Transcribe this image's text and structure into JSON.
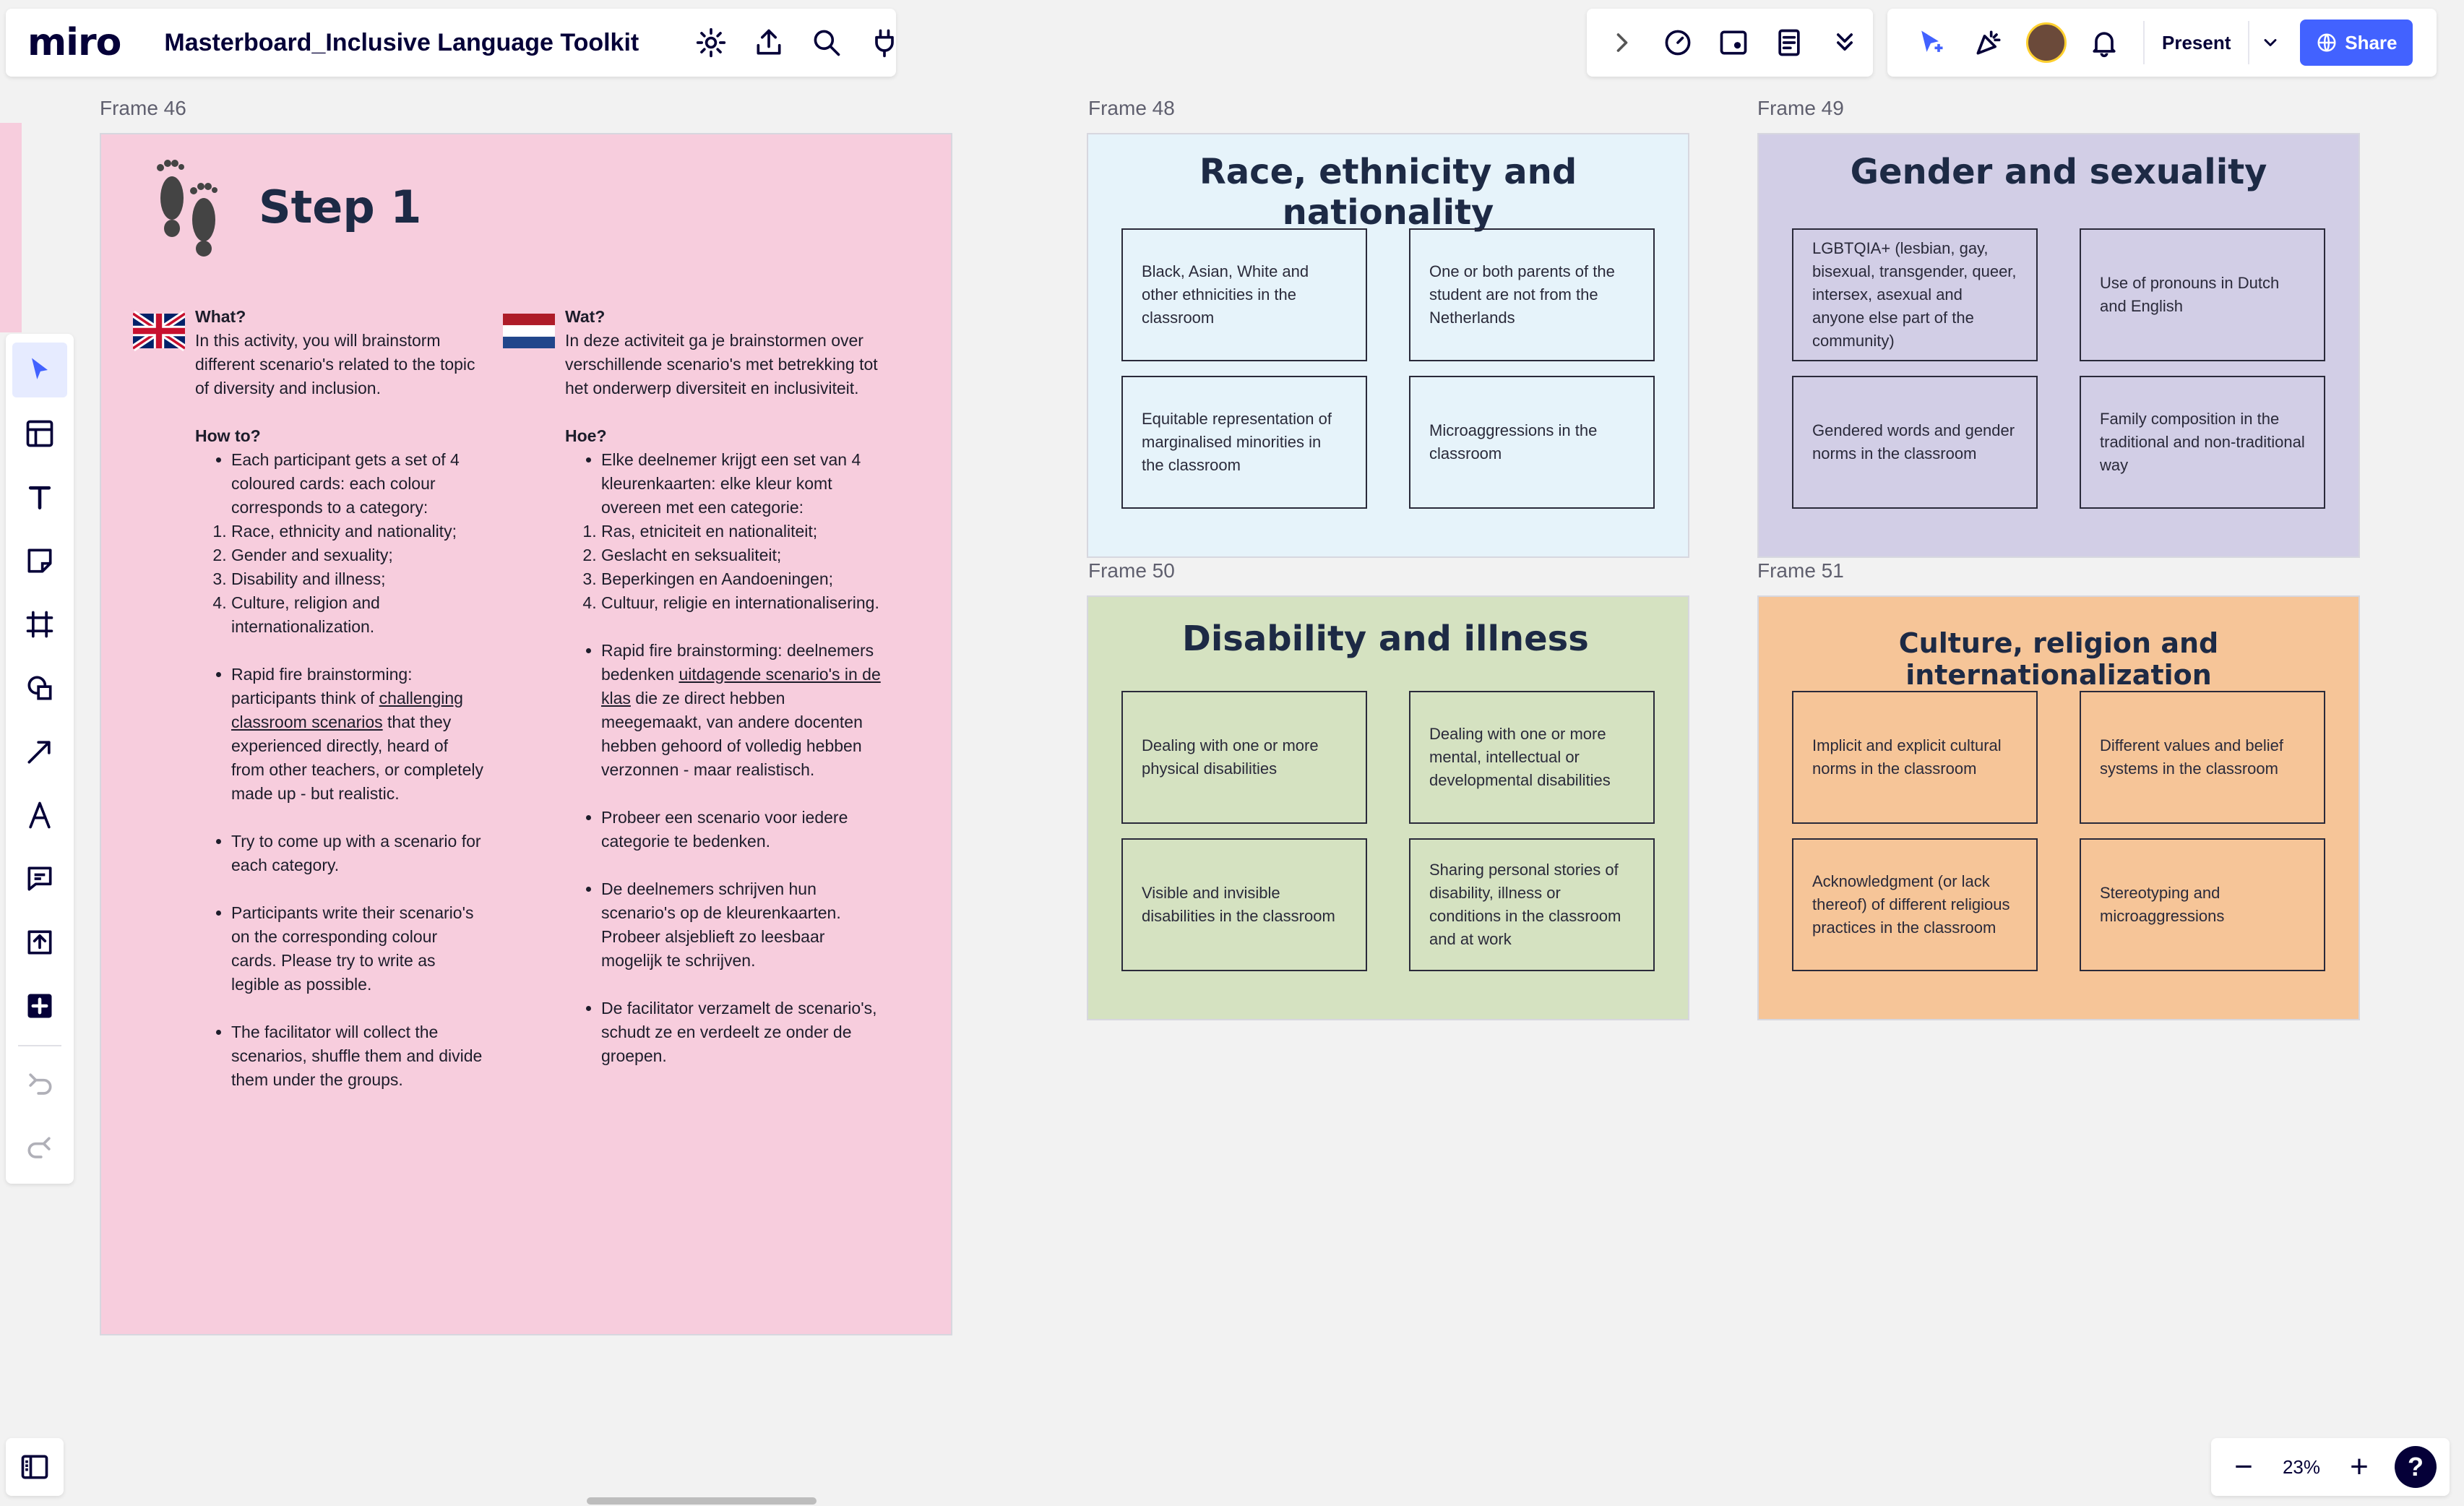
{
  "app": {
    "logo": "miro",
    "board_title": "Masterboard_Inclusive Language Toolkit",
    "present_label": "Present",
    "share_label": "Share",
    "zoom_level": "23%",
    "zoom_out": "−",
    "zoom_in": "+",
    "help": "?"
  },
  "frames": {
    "f46": {
      "label": "Frame 46",
      "step_title": "Step 1",
      "en": {
        "what_heading": "What?",
        "what_text": "In this activity, you will brainstorm different scenario's related to the topic of diversity and inclusion.",
        "howto_heading": "How to?",
        "bullet1": "Each participant gets a set of 4 coloured cards: each colour corresponds to a category:",
        "categories": [
          "Race, ethnicity and nationality;",
          "Gender and sexuality;",
          " Disability and illness;",
          "Culture, religion and internationalization."
        ],
        "bullet2_pre": "Rapid fire brainstorming: participants think of ",
        "bullet2_link": "challenging classroom scenarios",
        "bullet2_post": " that they experienced directly, heard of from other teachers, or completely made up - but realistic.",
        "bullet3": "Try to come up with a scenario for each category.",
        "bullet4": "Participants write their scenario's on the corresponding colour cards. Please try to write as legible as possible.",
        "bullet5": "The facilitator will collect the scenarios, shuffle them and divide them under the groups."
      },
      "nl": {
        "what_heading": "Wat?",
        "what_text": "In deze activiteit ga je brainstormen over verschillende scenario's met betrekking tot het onderwerp diversiteit en inclusiviteit.",
        "howto_heading": "Hoe?",
        "bullet1": "Elke deelnemer krijgt een set van 4 kleurenkaarten: elke kleur komt overeen met een categorie:",
        "categories": [
          "Ras, etniciteit en nationaliteit;",
          "Geslacht en seksualiteit;",
          "Beperkingen en Aandoeningen;",
          "Cultuur, religie en internationalisering."
        ],
        "bullet2_pre": "Rapid fire brainstorming: deelnemers bedenken ",
        "bullet2_link": "uitdagende scenario's in de klas",
        "bullet2_post": " die ze direct hebben meegemaakt, van andere docenten hebben gehoord of volledig hebben verzonnen - maar realistisch.",
        "bullet3": "Probeer een scenario voor iedere categorie te bedenken.",
        "bullet4": "De deelnemers schrijven hun scenario's op de kleurenkaarten. Probeer alsjeblieft zo leesbaar mogelijk te schrijven.",
        "bullet5": "De facilitator verzamelt de scenario's, schudt ze en verdeelt ze onder de groepen."
      }
    },
    "f48": {
      "label": "Frame 48",
      "title": "Race, ethnicity and nationality",
      "cards": [
        "Black, Asian, White and other ethnicities in the classroom",
        "One or both parents of the student are not from the Netherlands",
        "Equitable representation of marginalised minorities in the classroom",
        "Microaggressions in the classroom"
      ]
    },
    "f49": {
      "label": "Frame 49",
      "title": "Gender and sexuality",
      "cards": [
        "LGBTQIA+ (lesbian, gay, bisexual, transgender, queer, intersex, asexual and anyone else part of the community)",
        "Use of pronouns in Dutch and English",
        "Gendered words and gender norms in the classroom",
        "Family composition in the traditional and non-traditional way"
      ]
    },
    "f50": {
      "label": "Frame 50",
      "title": "Disability and illness",
      "cards": [
        "Dealing with one or more physical disabilities",
        "Dealing with one or more mental, intellectual or developmental disabilities",
        "Visible and invisible disabilities in the classroom",
        "Sharing personal stories of disability, illness or conditions in the classroom and at work"
      ]
    },
    "f51": {
      "label": "Frame 51",
      "title": "Culture, religion and internationalization",
      "cards": [
        "Implicit and explicit cultural norms in the classroom",
        "Different values and belief systems in the classroom",
        "Acknowledgment (or lack thereof) of different religious practices in the classroom",
        "Stereotyping and microaggressions"
      ]
    }
  },
  "colors": {
    "accent": "#4262ff",
    "frame46_bg": "#f7cddd",
    "frame48_bg": "#e6f3fa",
    "frame49_bg": "#d2cee6",
    "frame50_bg": "#d5e2c1",
    "frame51_bg": "#f6c598"
  }
}
